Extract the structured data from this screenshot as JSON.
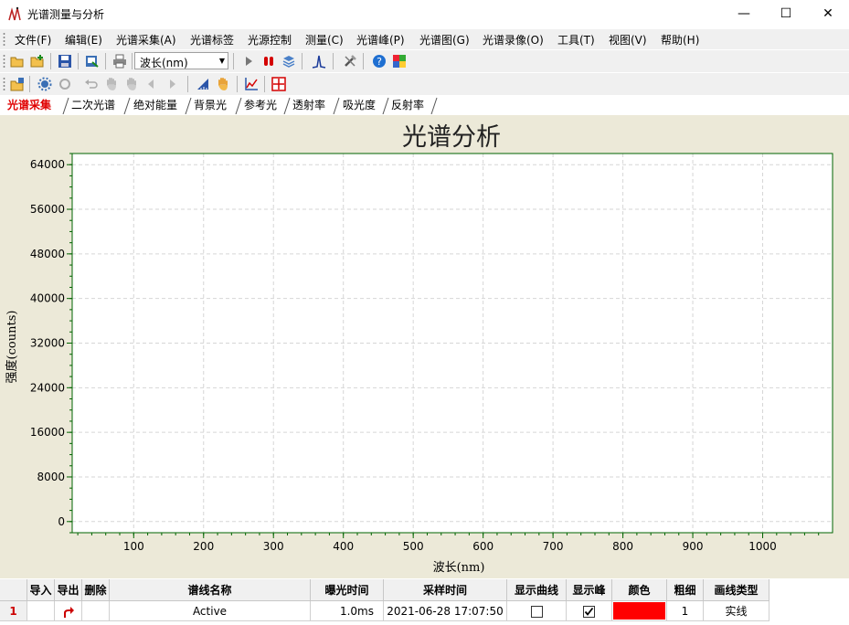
{
  "window": {
    "title": "光谱测量与分析",
    "minimize_glyph": "—",
    "maximize_glyph": "☐",
    "close_glyph": "✕"
  },
  "menu": [
    "文件(F)",
    "编辑(E)",
    "光谱采集(A)",
    "光谱标签",
    "光源控制",
    "测量(C)",
    "光谱峰(P)",
    "光谱图(G)",
    "光谱录像(O)",
    "工具(T)",
    "视图(V)",
    "帮助(H)"
  ],
  "toolbar": {
    "unit_select": "波长(nm)",
    "unit_arrow": "▼"
  },
  "tabs": [
    "光谱采集",
    "二次光谱",
    "绝对能量",
    "背景光",
    "参考光",
    "透射率",
    "吸光度",
    "反射率"
  ],
  "active_tab": 0,
  "chart_data": {
    "type": "line",
    "title": "光谱分析",
    "xlabel": "波长(nm)",
    "ylabel": "强度(counts)",
    "xlim": [
      12,
      1100
    ],
    "ylim": [
      -2000,
      66000
    ],
    "xticks": [
      100,
      200,
      300,
      400,
      500,
      600,
      700,
      800,
      900,
      1000
    ],
    "yticks": [
      0,
      8000,
      16000,
      24000,
      32000,
      40000,
      48000,
      56000,
      64000
    ],
    "grid": true,
    "series": []
  },
  "table": {
    "headers": [
      "",
      "导入",
      "导出",
      "删除",
      "谱线名称",
      "曝光时间",
      "采样时间",
      "显示曲线",
      "显示峰",
      "颜色",
      "粗细",
      "画线类型"
    ],
    "rows": [
      {
        "index": "1",
        "name": "Active",
        "exposure": "1.0ms",
        "sample_time": "2021-06-28 17:07:50",
        "show_curve": false,
        "show_peak": true,
        "color": "#ff0000",
        "width": "1",
        "line_type": "实线"
      }
    ]
  },
  "colors": {
    "axis": "#006400",
    "grid": "#d6d6d6",
    "plot_bg": "#ffffff",
    "chart_bg": "#ece9d8",
    "active_tab": "#e00000"
  }
}
